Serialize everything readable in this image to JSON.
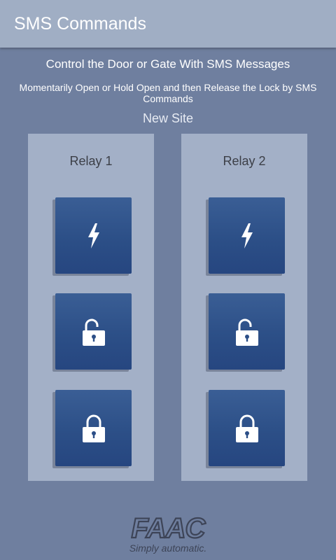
{
  "app_bar": {
    "title": "SMS Commands"
  },
  "intro": {
    "heading": "Control the Door or Gate With SMS Messages",
    "description": "Momentarily Open or Hold Open and then Release the Lock by SMS Commands",
    "site_name": "New Site"
  },
  "relays": [
    {
      "label": "Relay 1",
      "buttons": [
        {
          "icon": "lightning-bolt-icon"
        },
        {
          "icon": "unlocked-padlock-icon"
        },
        {
          "icon": "locked-padlock-icon"
        }
      ]
    },
    {
      "label": "Relay 2",
      "buttons": [
        {
          "icon": "lightning-bolt-icon"
        },
        {
          "icon": "unlocked-padlock-icon"
        },
        {
          "icon": "locked-padlock-icon"
        }
      ]
    }
  ],
  "branding": {
    "logo_text": "FAAC",
    "tagline": "Simply automatic."
  },
  "colors": {
    "background": "#6f7f9f",
    "app_bar": "#a0aec4",
    "panel": "#a3b0c7",
    "button": "#2c4f87",
    "text_light": "#ffffff",
    "text_dark": "#3c3f47"
  }
}
